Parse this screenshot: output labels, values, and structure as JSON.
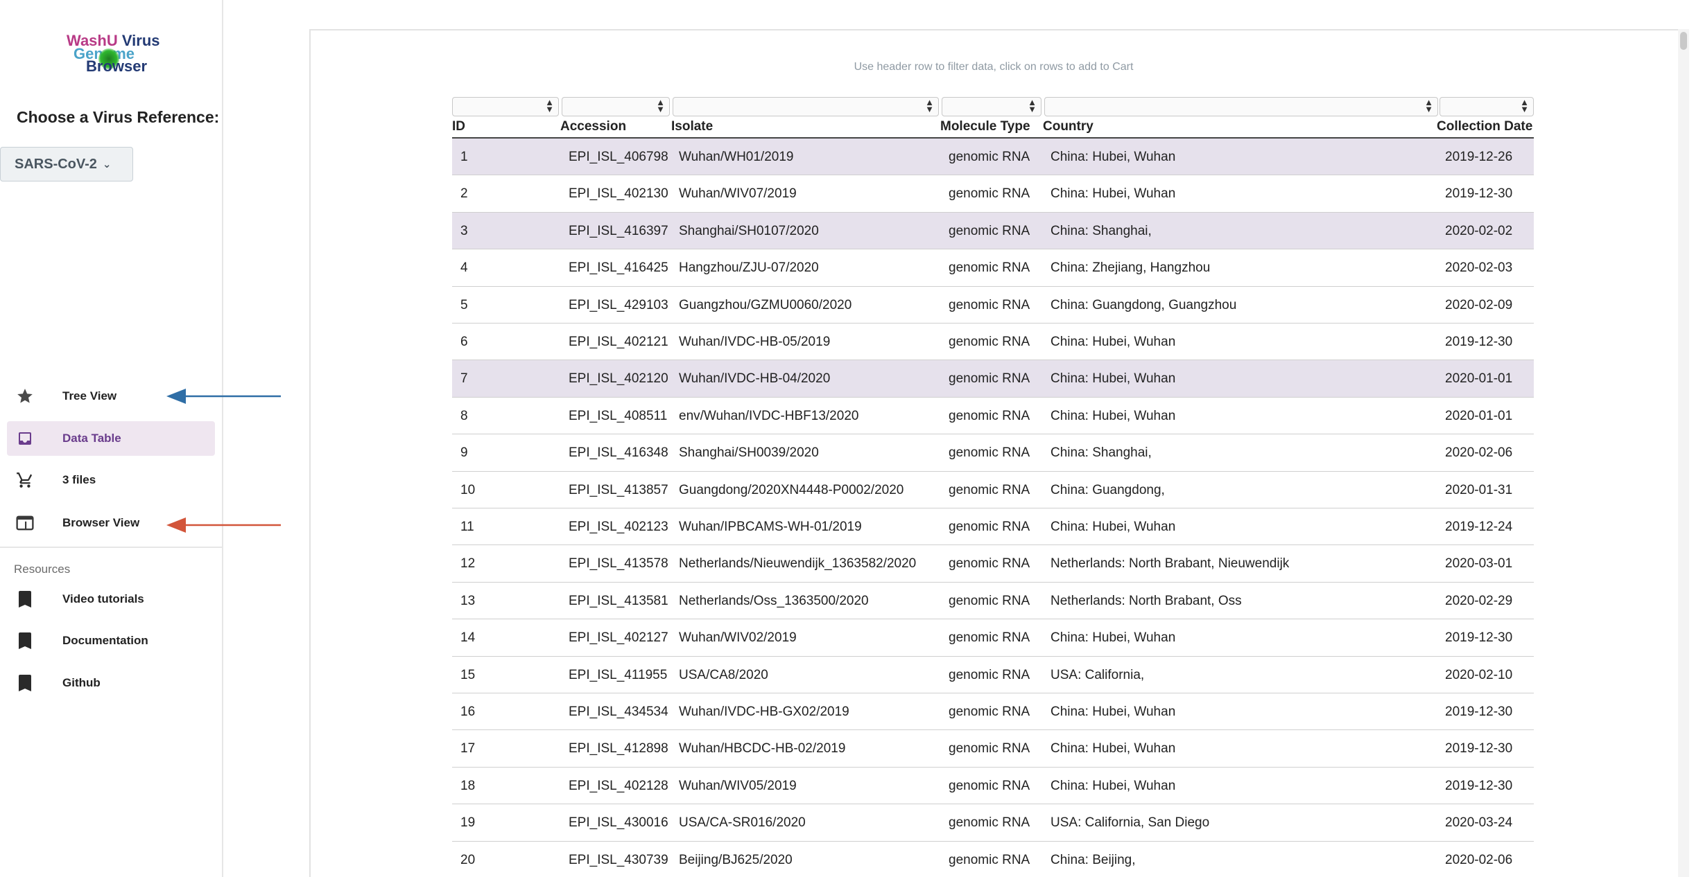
{
  "logo": {
    "line1a": "WashU",
    "line1b": "Virus",
    "line2": "Genome",
    "line3": "Browser"
  },
  "sidebar": {
    "choose_label": "Choose a Virus Reference:",
    "reference": "SARS-CoV-2",
    "nav": [
      {
        "label": "Tree View",
        "icon": "star-icon"
      },
      {
        "label": "Data Table",
        "icon": "inbox-icon"
      },
      {
        "label": "3 files",
        "icon": "cart-icon"
      },
      {
        "label": "Browser View",
        "icon": "browser-window-icon"
      }
    ],
    "resources_label": "Resources",
    "resources": [
      {
        "label": "Video tutorials",
        "icon": "bookmark-icon"
      },
      {
        "label": "Documentation",
        "icon": "bookmark-icon"
      },
      {
        "label": "Github",
        "icon": "bookmark-icon"
      }
    ]
  },
  "annotations": {
    "blue_arrow_color": "#2f6ea6",
    "red_arrow_color": "#d2553a"
  },
  "table": {
    "hint": "Use header row to filter data, click on rows to add to Cart",
    "columns": [
      "ID",
      "Accession",
      "Isolate",
      "Molecule Type",
      "Country",
      "Collection Date"
    ],
    "rows": [
      [
        "1",
        "EPI_ISL_406798",
        "Wuhan/WH01/2019",
        "genomic RNA",
        "China: Hubei, Wuhan",
        "2019-12-26"
      ],
      [
        "2",
        "EPI_ISL_402130",
        "Wuhan/WIV07/2019",
        "genomic RNA",
        "China: Hubei, Wuhan",
        "2019-12-30"
      ],
      [
        "3",
        "EPI_ISL_416397",
        "Shanghai/SH0107/2020",
        "genomic RNA",
        "China: Shanghai,",
        "2020-02-02"
      ],
      [
        "4",
        "EPI_ISL_416425",
        "Hangzhou/ZJU-07/2020",
        "genomic RNA",
        "China: Zhejiang, Hangzhou",
        "2020-02-03"
      ],
      [
        "5",
        "EPI_ISL_429103",
        "Guangzhou/GZMU0060/2020",
        "genomic RNA",
        "China: Guangdong, Guangzhou",
        "2020-02-09"
      ],
      [
        "6",
        "EPI_ISL_402121",
        "Wuhan/IVDC-HB-05/2019",
        "genomic RNA",
        "China: Hubei, Wuhan",
        "2019-12-30"
      ],
      [
        "7",
        "EPI_ISL_402120",
        "Wuhan/IVDC-HB-04/2020",
        "genomic RNA",
        "China: Hubei, Wuhan",
        "2020-01-01"
      ],
      [
        "8",
        "EPI_ISL_408511",
        "env/Wuhan/IVDC-HBF13/2020",
        "genomic RNA",
        "China: Hubei, Wuhan",
        "2020-01-01"
      ],
      [
        "9",
        "EPI_ISL_416348",
        "Shanghai/SH0039/2020",
        "genomic RNA",
        "China: Shanghai,",
        "2020-02-06"
      ],
      [
        "10",
        "EPI_ISL_413857",
        "Guangdong/2020XN4448-P0002/2020",
        "genomic RNA",
        "China: Guangdong,",
        "2020-01-31"
      ],
      [
        "11",
        "EPI_ISL_402123",
        "Wuhan/IPBCAMS-WH-01/2019",
        "genomic RNA",
        "China: Hubei, Wuhan",
        "2019-12-24"
      ],
      [
        "12",
        "EPI_ISL_413578",
        "Netherlands/Nieuwendijk_1363582/2020",
        "genomic RNA",
        "Netherlands: North Brabant, Nieuwendijk",
        "2020-03-01"
      ],
      [
        "13",
        "EPI_ISL_413581",
        "Netherlands/Oss_1363500/2020",
        "genomic RNA",
        "Netherlands: North Brabant, Oss",
        "2020-02-29"
      ],
      [
        "14",
        "EPI_ISL_402127",
        "Wuhan/WIV02/2019",
        "genomic RNA",
        "China: Hubei, Wuhan",
        "2019-12-30"
      ],
      [
        "15",
        "EPI_ISL_411955",
        "USA/CA8/2020",
        "genomic RNA",
        "USA: California,",
        "2020-02-10"
      ],
      [
        "16",
        "EPI_ISL_434534",
        "Wuhan/IVDC-HB-GX02/2019",
        "genomic RNA",
        "China: Hubei, Wuhan",
        "2019-12-30"
      ],
      [
        "17",
        "EPI_ISL_412898",
        "Wuhan/HBCDC-HB-02/2019",
        "genomic RNA",
        "China: Hubei, Wuhan",
        "2019-12-30"
      ],
      [
        "18",
        "EPI_ISL_402128",
        "Wuhan/WIV05/2019",
        "genomic RNA",
        "China: Hubei, Wuhan",
        "2019-12-30"
      ],
      [
        "19",
        "EPI_ISL_430016",
        "USA/CA-SR016/2020",
        "genomic RNA",
        "USA: California, San Diego",
        "2020-03-24"
      ],
      [
        "20",
        "EPI_ISL_430739",
        "Beijing/BJ625/2020",
        "genomic RNA",
        "China: Beijing,",
        "2020-02-06"
      ]
    ],
    "selected_rows": [
      1,
      3,
      7
    ]
  }
}
